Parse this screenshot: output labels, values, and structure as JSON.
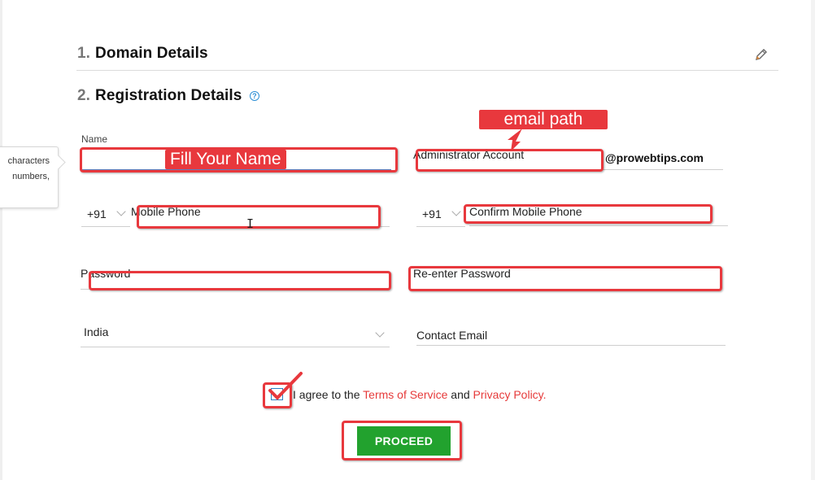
{
  "sections": {
    "domain": {
      "number": "1.",
      "title": "Domain Details",
      "edit_icon": "pencil-icon"
    },
    "registration": {
      "number": "2.",
      "title": "Registration Details",
      "help_icon": "question-circle-icon",
      "help_glyph": "?"
    }
  },
  "tooltip": {
    "line1": "characters",
    "line2": "numbers,"
  },
  "form": {
    "name": {
      "label": "Name",
      "value": ""
    },
    "admin_account": {
      "placeholder": "Administrator Account",
      "suffix": "@prowebtips.com"
    },
    "mobile": {
      "country_code": "+91",
      "placeholder": "Mobile Phone"
    },
    "confirm_mobile": {
      "country_code": "+91",
      "placeholder": "Confirm Mobile Phone"
    },
    "password": {
      "placeholder": "Password"
    },
    "reenter_password": {
      "placeholder": "Re-enter Password"
    },
    "country": {
      "selected": "India"
    },
    "contact_email": {
      "placeholder": "Contact Email"
    },
    "agree": {
      "prefix": "I agree to the",
      "terms_link": "Terms of Service",
      "conjunction": "and",
      "privacy_link": "Privacy Policy",
      "suffix": "."
    },
    "proceed_label": "PROCEED"
  },
  "annotations": {
    "fill_name": "Fill Your Name",
    "email_path": "email path"
  },
  "colors": {
    "annotation_red": "#e8383d",
    "proceed_green": "#22a22e",
    "link_red": "#e63a3a",
    "help_blue": "#2d8fd5"
  }
}
